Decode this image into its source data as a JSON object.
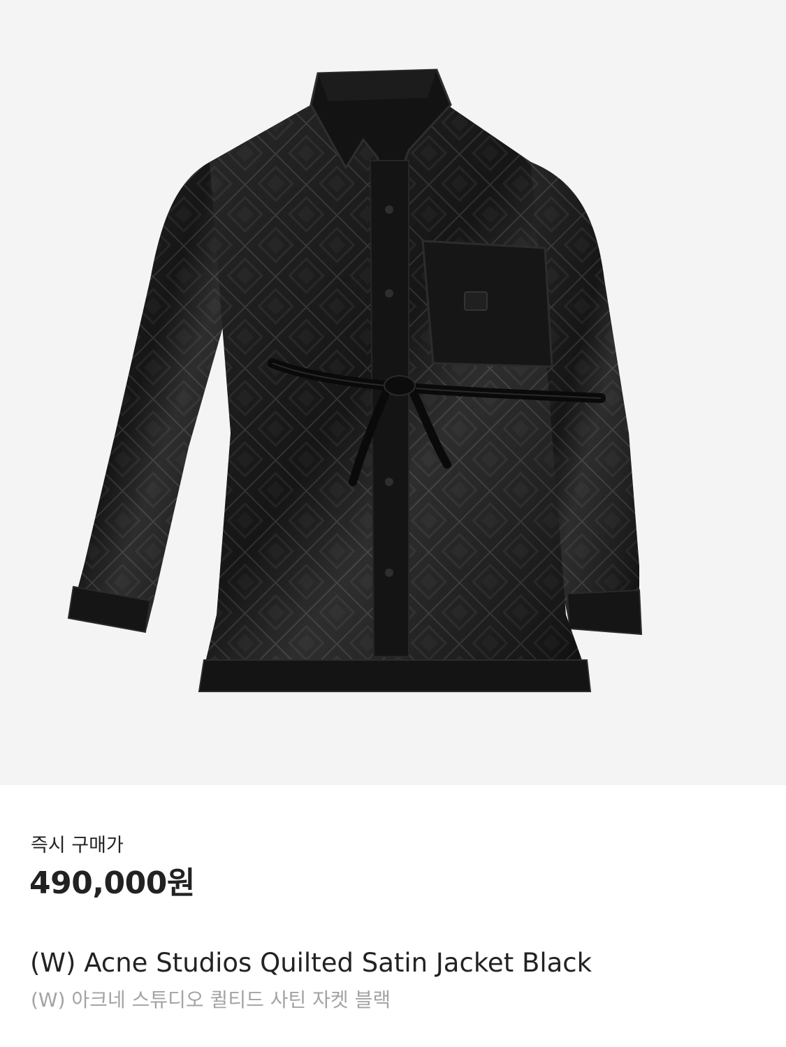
{
  "product": {
    "image_alt": "jacket-photo",
    "price_label": "즉시 구매가",
    "price": "490,000원",
    "name_en": "(W) Acne Studios Quilted Satin Jacket Black",
    "name_ko": "(W) 아크네 스튜디오 퀼티드 사틴 자켓 블랙"
  },
  "colors": {
    "image_background": "#f4f4f4",
    "page_background": "#ffffff",
    "primary_text": "#222222",
    "secondary_text": "#a3a3a3",
    "jacket": "#0d0d0d"
  }
}
